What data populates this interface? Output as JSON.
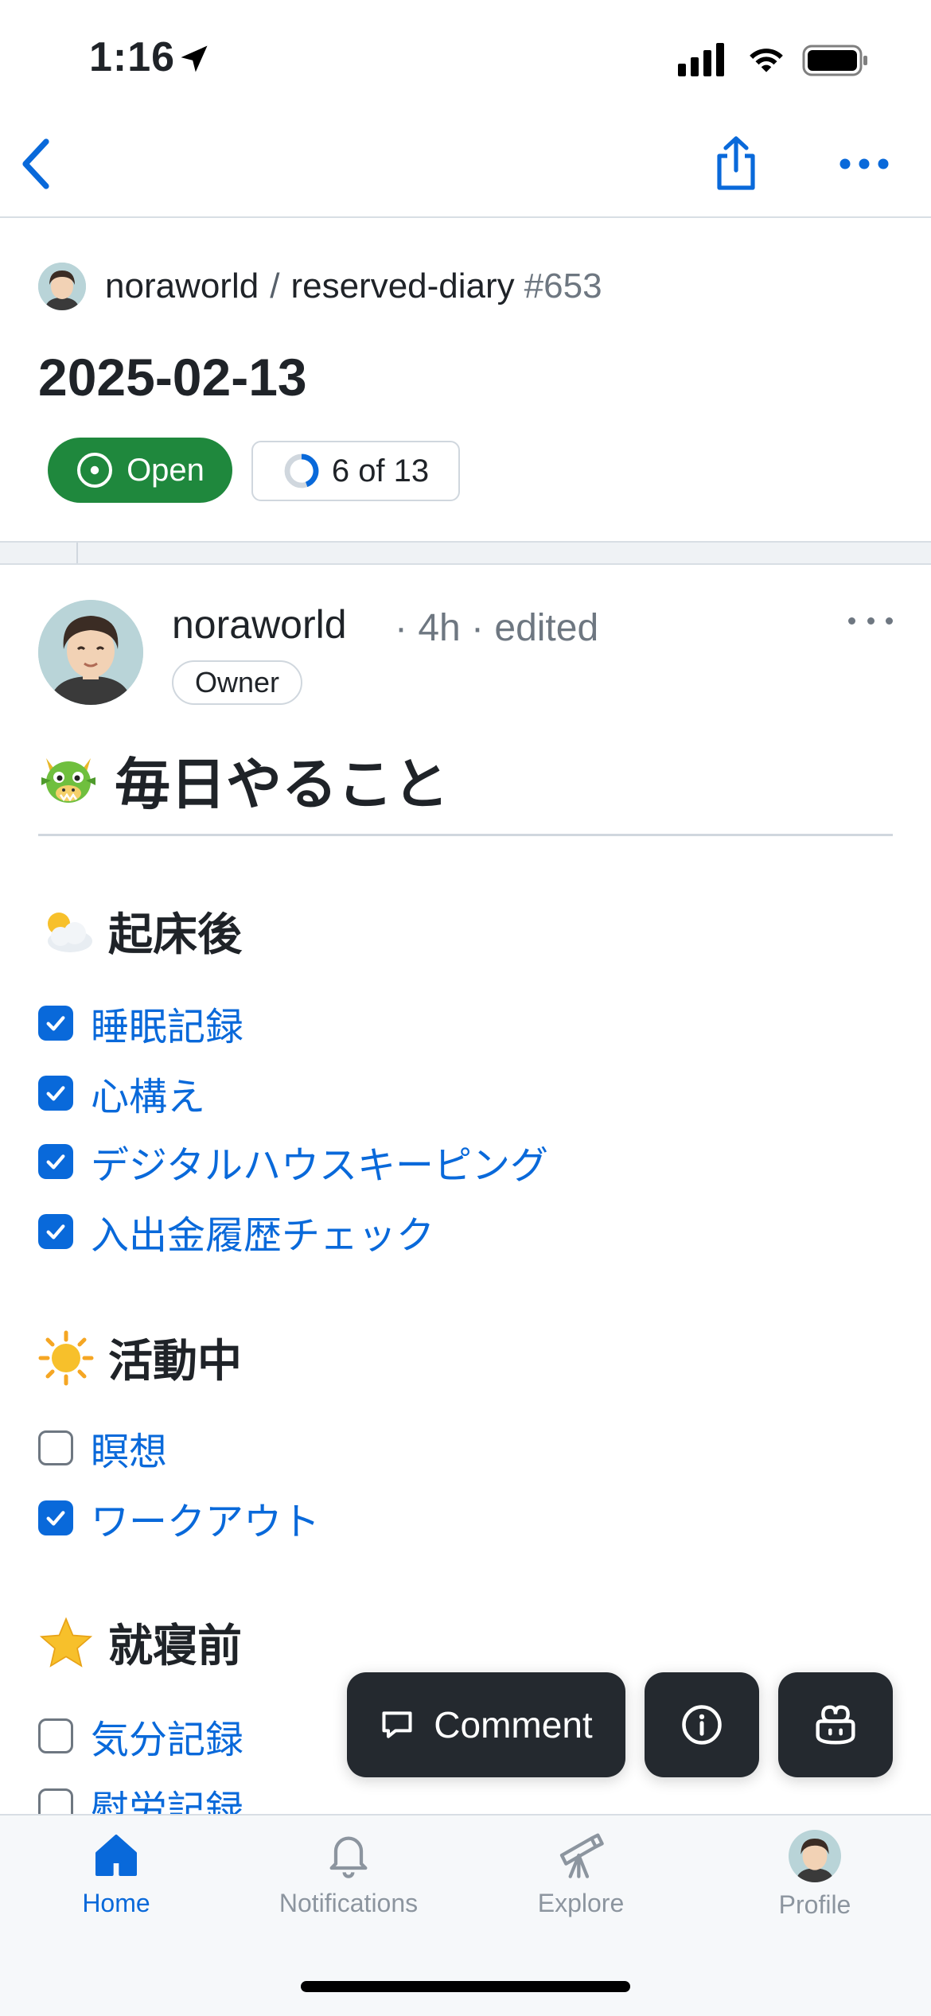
{
  "status_bar": {
    "time": "1:16"
  },
  "repo": {
    "owner": "noraworld",
    "separator": "/",
    "name": "reserved-diary",
    "number": "#653"
  },
  "issue": {
    "title": "2025-02-13",
    "state": "Open",
    "progress": "6 of 13"
  },
  "comment": {
    "author": "noraworld",
    "meta": "· 4h · edited",
    "role": "Owner",
    "heading": "毎日やること",
    "sections": [
      {
        "title": "起床後",
        "tasks": [
          {
            "label": "睡眠記録",
            "checked": true
          },
          {
            "label": "心構え",
            "checked": true
          },
          {
            "label": "デジタルハウスキーピング",
            "checked": true
          },
          {
            "label": "入出金履歴チェック",
            "checked": true
          }
        ]
      },
      {
        "title": "活動中",
        "tasks": [
          {
            "label": "瞑想",
            "checked": false
          },
          {
            "label": "ワークアウト",
            "checked": true
          }
        ]
      },
      {
        "title": "就寝前",
        "tasks": [
          {
            "label": "気分記録",
            "checked": false
          },
          {
            "label": "慰労記録",
            "checked": false
          }
        ]
      }
    ]
  },
  "actions": {
    "comment_label": "Comment"
  },
  "tab_bar": [
    {
      "label": "Home",
      "icon": "home-icon",
      "active": true
    },
    {
      "label": "Notifications",
      "icon": "bell-icon",
      "active": false
    },
    {
      "label": "Explore",
      "icon": "telescope-icon",
      "active": false
    },
    {
      "label": "Profile",
      "icon": "avatar",
      "active": false
    }
  ],
  "colors": {
    "accent": "#0969da",
    "open_green": "#1f883d",
    "fab_bg": "#24292f"
  }
}
